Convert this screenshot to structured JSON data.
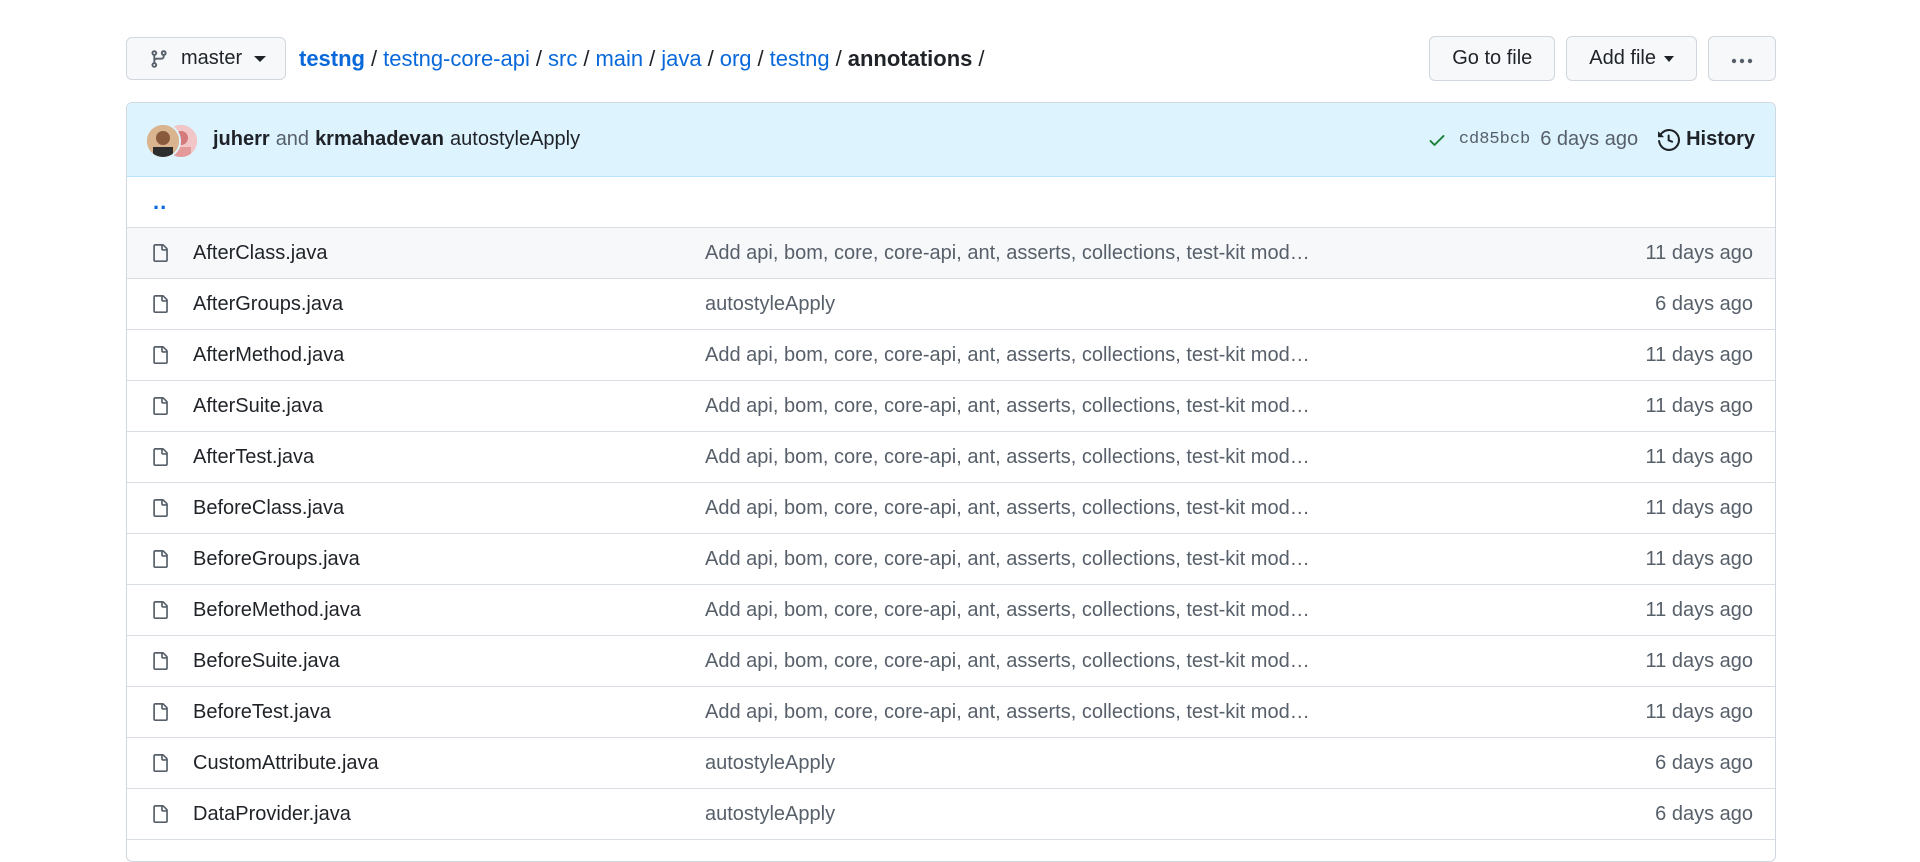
{
  "branch": {
    "label": "master"
  },
  "breadcrumb": {
    "root": "testng",
    "links": [
      "testng-core-api",
      "src",
      "main",
      "java",
      "org",
      "testng"
    ],
    "current": "annotations",
    "separator": "/"
  },
  "actions": {
    "go_to_file": "Go to file",
    "add_file": "Add file",
    "more": "···"
  },
  "commit": {
    "author1": "juherr",
    "conjunction": "and",
    "author2": "krmahadevan",
    "message": "autostyleApply",
    "sha": "cd85bcb",
    "time": "6 days ago",
    "history_label": "History",
    "status_color": "#1a7f37"
  },
  "parent_link": "..",
  "files": [
    {
      "name": "AfterClass.java",
      "message": "Add api, bom, core, core-api, ant, asserts, collections, test-kit mod…",
      "date": "11 days ago"
    },
    {
      "name": "AfterGroups.java",
      "message": "autostyleApply",
      "date": "6 days ago"
    },
    {
      "name": "AfterMethod.java",
      "message": "Add api, bom, core, core-api, ant, asserts, collections, test-kit mod…",
      "date": "11 days ago"
    },
    {
      "name": "AfterSuite.java",
      "message": "Add api, bom, core, core-api, ant, asserts, collections, test-kit mod…",
      "date": "11 days ago"
    },
    {
      "name": "AfterTest.java",
      "message": "Add api, bom, core, core-api, ant, asserts, collections, test-kit mod…",
      "date": "11 days ago"
    },
    {
      "name": "BeforeClass.java",
      "message": "Add api, bom, core, core-api, ant, asserts, collections, test-kit mod…",
      "date": "11 days ago"
    },
    {
      "name": "BeforeGroups.java",
      "message": "Add api, bom, core, core-api, ant, asserts, collections, test-kit mod…",
      "date": "11 days ago"
    },
    {
      "name": "BeforeMethod.java",
      "message": "Add api, bom, core, core-api, ant, asserts, collections, test-kit mod…",
      "date": "11 days ago"
    },
    {
      "name": "BeforeSuite.java",
      "message": "Add api, bom, core, core-api, ant, asserts, collections, test-kit mod…",
      "date": "11 days ago"
    },
    {
      "name": "BeforeTest.java",
      "message": "Add api, bom, core, core-api, ant, asserts, collections, test-kit mod…",
      "date": "11 days ago"
    },
    {
      "name": "CustomAttribute.java",
      "message": "autostyleApply",
      "date": "6 days ago"
    },
    {
      "name": "DataProvider.java",
      "message": "autostyleApply",
      "date": "6 days ago"
    }
  ]
}
